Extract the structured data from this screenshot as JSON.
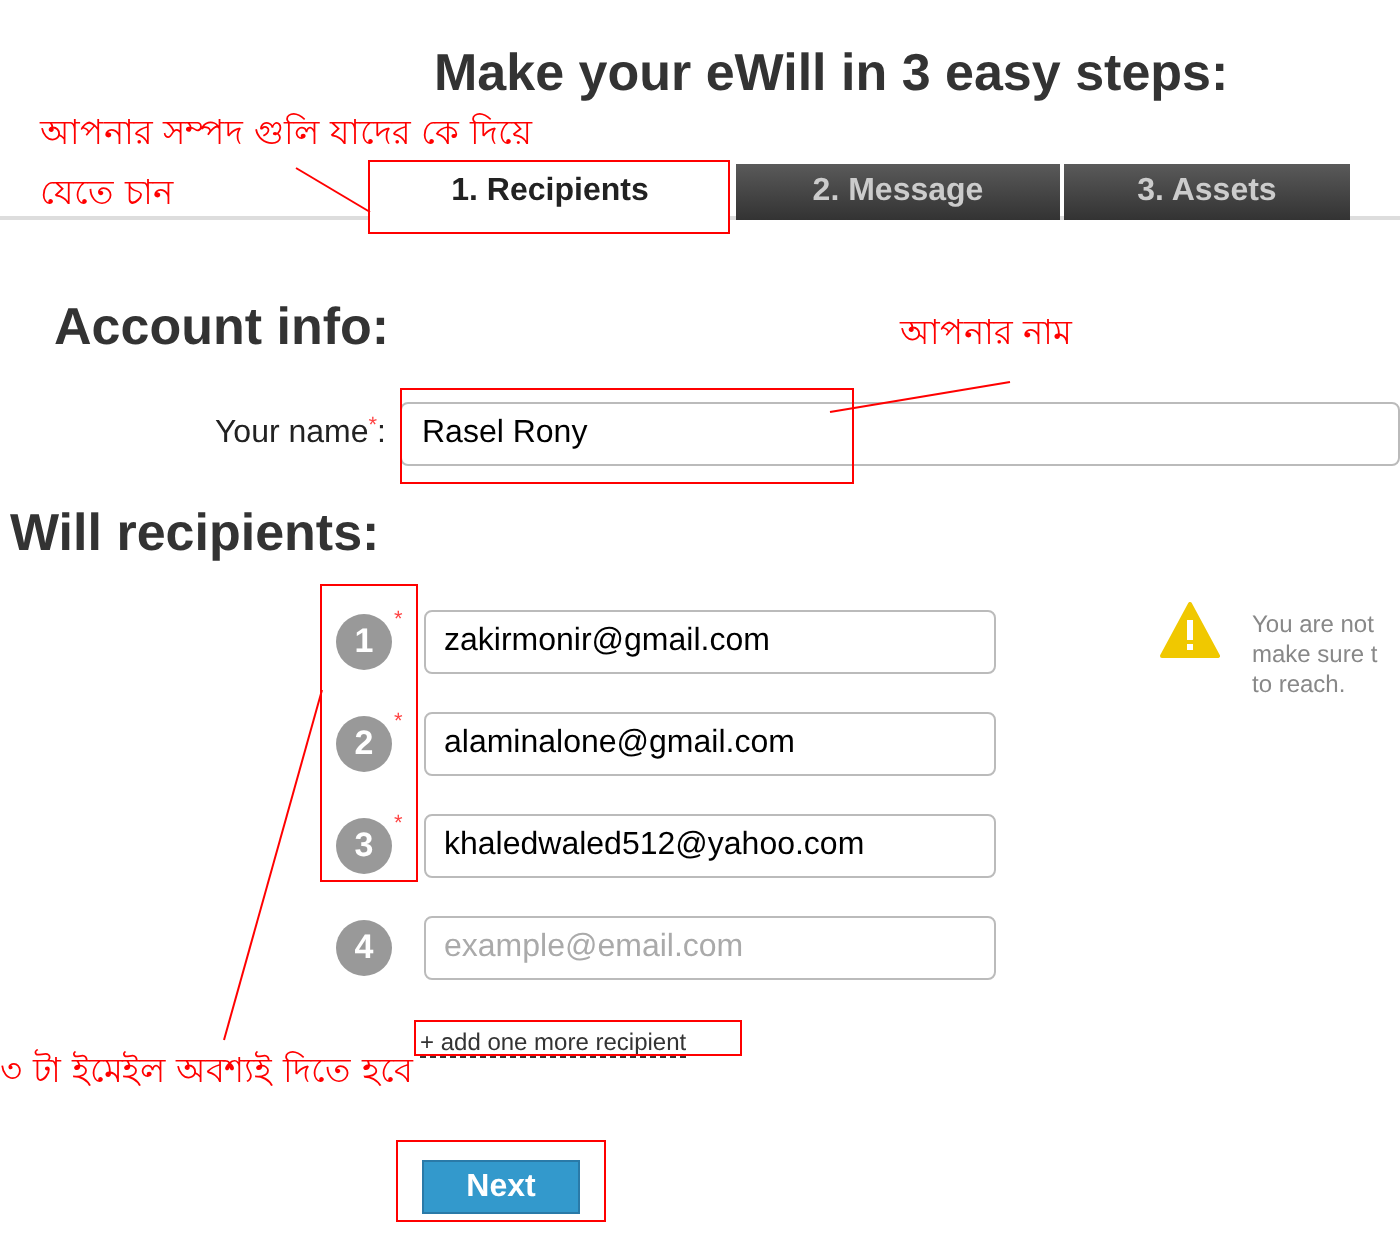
{
  "title": "Make your eWill in 3 easy steps:",
  "tabs": [
    {
      "label": "1. Recipients",
      "selected": true
    },
    {
      "label": "2. Message",
      "selected": false
    },
    {
      "label": "3. Assets",
      "selected": false
    }
  ],
  "account_info": {
    "heading": "Account info:",
    "name_label": "Your name",
    "required_mark": "*",
    "separator": ":",
    "name_value": "Rasel Rony"
  },
  "will_recipients": {
    "heading": "Will recipients:",
    "rows": [
      {
        "number": "1",
        "required_mark": "*",
        "value": "zakirmonir@gmail.com"
      },
      {
        "number": "2",
        "required_mark": "*",
        "value": "alaminalone@gmail.com"
      },
      {
        "number": "3",
        "required_mark": "*",
        "value": "khaledwaled512@yahoo.com"
      },
      {
        "number": "4",
        "placeholder": "example@email.com"
      }
    ],
    "warning_lines": [
      "You are not",
      "make sure t",
      "to reach."
    ],
    "add_link": "+ add one more recipient"
  },
  "next_button": "Next",
  "annotations": [
    {
      "text": "আপনার সম্পদ গুলি যাদের কে দিয়ে"
    },
    {
      "text": "যেতে চান"
    },
    {
      "text": "আপনার নাম"
    },
    {
      "text": "৩ টা ইমেইল অবশ্যই দিতে হবে"
    }
  ]
}
